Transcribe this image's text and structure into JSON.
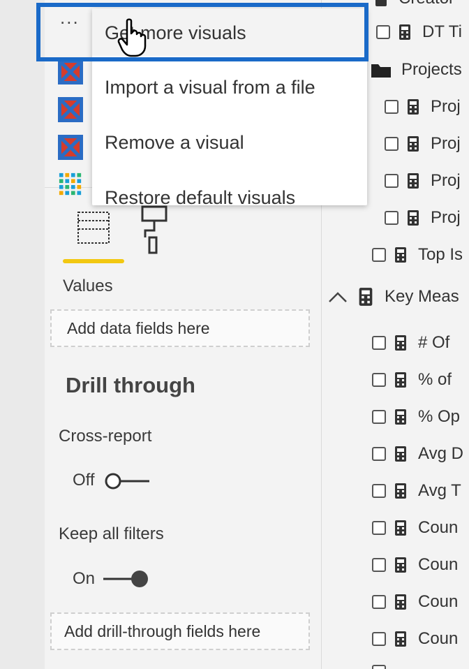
{
  "visualizations": {
    "more_label": "...",
    "icons": [
      "custom-visual-icon",
      "custom-visual-icon",
      "custom-visual-icon",
      "grid-visual-icon"
    ],
    "tabs": [
      "fields-tab-icon",
      "format-paint-roller-icon"
    ],
    "values_label": "Values",
    "values_placeholder": "Add data fields here",
    "drill_title": "Drill through",
    "cross_report_label": "Cross-report",
    "cross_report_state": "Off",
    "keep_filters_label": "Keep all filters",
    "keep_filters_state": "On",
    "drill_placeholder": "Add drill-through fields here"
  },
  "context_menu": {
    "items": [
      "Get more visuals",
      "Import a visual from a file",
      "Remove a visual",
      "Restore default visuals"
    ]
  },
  "fields": {
    "rows": [
      {
        "label": "Creator"
      },
      {
        "label": "DT Ti"
      },
      {
        "label": "Projects"
      },
      {
        "label": "Proj"
      },
      {
        "label": "Proj"
      },
      {
        "label": "Proj"
      },
      {
        "label": "Proj"
      },
      {
        "label": "Top Is"
      },
      {
        "label": "Key Meas"
      },
      {
        "label": "# Of"
      },
      {
        "label": "% of"
      },
      {
        "label": "% Op"
      },
      {
        "label": "Avg D"
      },
      {
        "label": "Avg T"
      },
      {
        "label": "Coun"
      },
      {
        "label": "Coun"
      },
      {
        "label": "Coun"
      },
      {
        "label": "Coun"
      }
    ]
  },
  "colors": {
    "accent_yellow": "#f2c811",
    "highlight_blue": "#1a6ac8",
    "custom_visual_red": "#d43c2c",
    "custom_visual_blue": "#2b6cc4"
  }
}
